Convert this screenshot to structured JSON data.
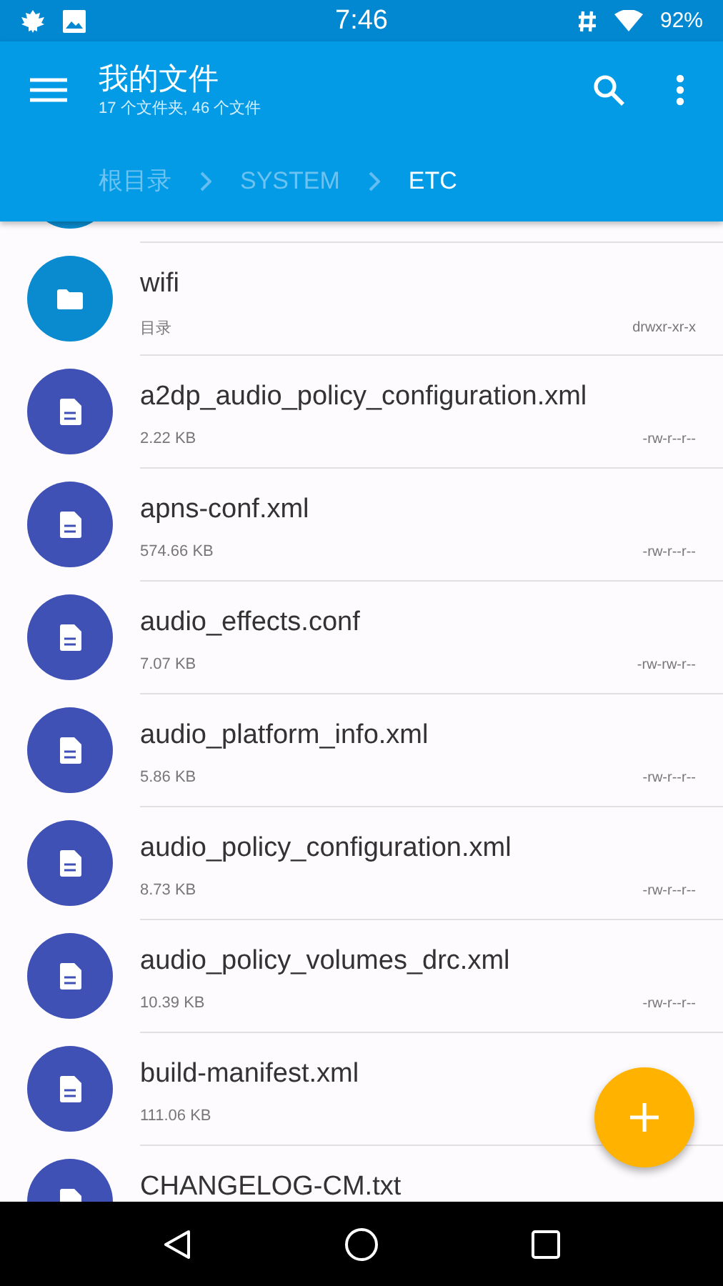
{
  "status_bar": {
    "time": "7:46",
    "battery": "92%"
  },
  "app_bar": {
    "title": "我的文件",
    "subtitle": "17 个文件夹, 46 个文件"
  },
  "breadcrumbs": [
    {
      "label": "根目录",
      "selected": false
    },
    {
      "label": "SYSTEM",
      "selected": false
    },
    {
      "label": "ETC",
      "selected": true
    }
  ],
  "files": [
    {
      "kind": "folder"
    },
    {
      "kind": "folder",
      "name": "wifi",
      "detail": "目录",
      "permissions": "drwxr-xr-x"
    },
    {
      "kind": "file",
      "name": "a2dp_audio_policy_configuration.xml",
      "detail": "2.22 KB",
      "permissions": "-rw-r--r--"
    },
    {
      "kind": "file",
      "name": "apns-conf.xml",
      "detail": "574.66 KB",
      "permissions": "-rw-r--r--"
    },
    {
      "kind": "file",
      "name": "audio_effects.conf",
      "detail": "7.07 KB",
      "permissions": "-rw-rw-r--"
    },
    {
      "kind": "file",
      "name": "audio_platform_info.xml",
      "detail": "5.86 KB",
      "permissions": "-rw-r--r--"
    },
    {
      "kind": "file",
      "name": "audio_policy_configuration.xml",
      "detail": "8.73 KB",
      "permissions": "-rw-r--r--"
    },
    {
      "kind": "file",
      "name": "audio_policy_volumes_drc.xml",
      "detail": "10.39 KB",
      "permissions": "-rw-r--r--"
    },
    {
      "kind": "file",
      "name": "build-manifest.xml",
      "detail": "111.06 KB"
    },
    {
      "kind": "file",
      "name": "CHANGELOG-CM.txt"
    }
  ]
}
